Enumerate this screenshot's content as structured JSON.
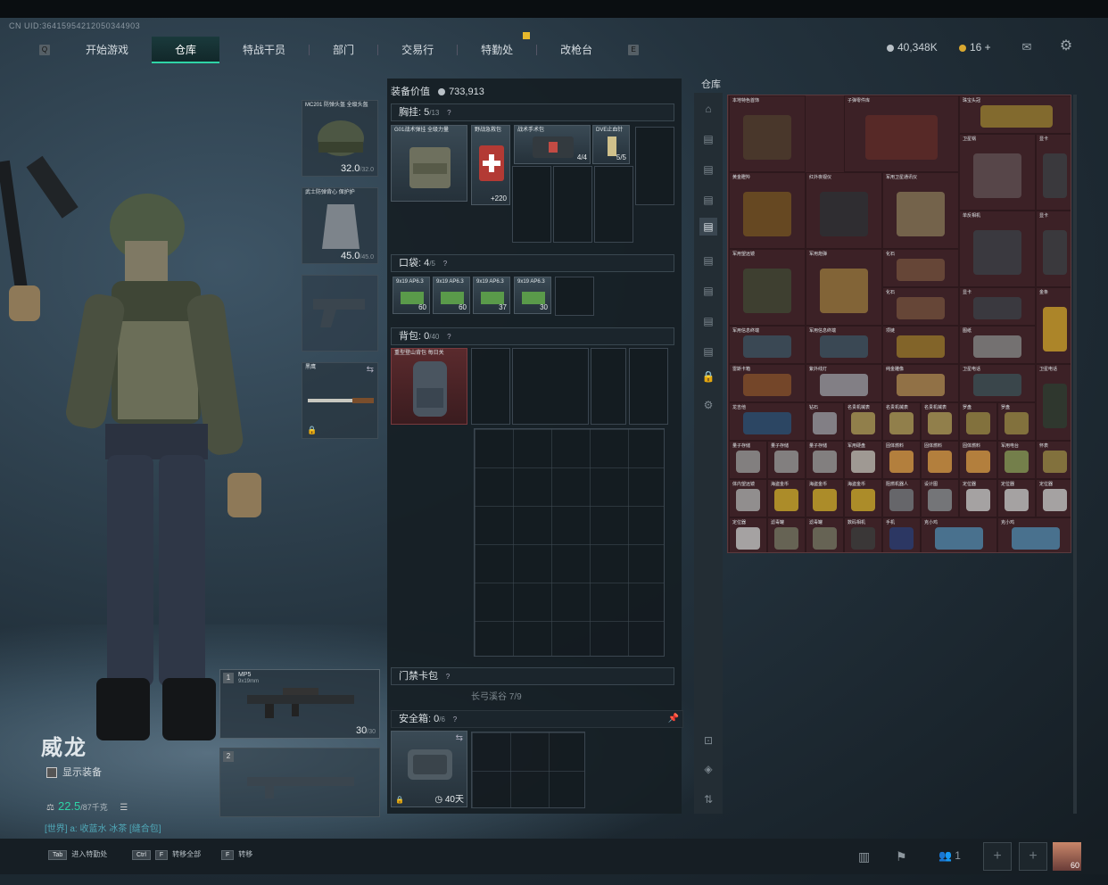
{
  "uid": "CN UID:3641595421205034490​3",
  "nav": {
    "items": [
      "开始游戏",
      "仓库",
      "特战干员",
      "部门",
      "交易行",
      "特勤处",
      "改枪台"
    ],
    "active": "仓库",
    "left_key": "Q",
    "right_key": "E"
  },
  "resources": {
    "currency": "40,348K",
    "coins": "16 +"
  },
  "operator": {
    "name": "威龙",
    "show_gear": "显示装备",
    "weight": "22.5",
    "weight_max": "/87千克",
    "chat": "[世界] a: 收蓝水 冰茶 [缝合包]"
  },
  "equipment": {
    "helmet": {
      "label": "MC201 防弹头盔 全级头盔",
      "value": "32.0",
      "max": "/32.0"
    },
    "armor": {
      "label": "武士防弹背心 保护护",
      "value": "45.0",
      "max": "/45.0"
    },
    "melee": {
      "label": "黑鹰"
    },
    "weapon1": {
      "slot": "1",
      "name": "MP5",
      "ammo_type": "9x19mm",
      "ammo": "30",
      "ammo_max": "/30"
    },
    "weapon2": {
      "slot": "2"
    }
  },
  "loadout": {
    "value_label": "装备价值",
    "value": "733,913",
    "chest": {
      "title": "胸挂:",
      "count": "5",
      "max": "/13"
    },
    "chest_items": [
      {
        "label": "G01战术弹挂 全级力量"
      },
      {
        "label": "野战急救包",
        "count": "+220"
      },
      {
        "label": "战术手术包",
        "count": "4/4"
      },
      {
        "label": "DVE止血针",
        "count": "5/5"
      }
    ],
    "pocket": {
      "title": "口袋:",
      "count": "4",
      "max": "/5"
    },
    "pocket_items": [
      {
        "label": "9x19 AP6.3",
        "count": "60"
      },
      {
        "label": "9x19 AP6.3",
        "count": "60"
      },
      {
        "label": "9x19 AP6.3",
        "count": "37"
      },
      {
        "label": "9x19 AP6.3",
        "count": "30"
      }
    ],
    "backpack": {
      "title": "背包:",
      "count": "0",
      "max": "/40",
      "label": "重型登山背包 每日关"
    },
    "keycard": {
      "title": "门禁卡包",
      "sub": "长弓溪谷 7/9"
    },
    "safebox": {
      "title": "安全箱:",
      "count": "0",
      "max": "/6",
      "duration": "40天"
    }
  },
  "stash": {
    "title": "仓库",
    "items": [
      {
        "label": "本地特色首饰"
      },
      {
        "label": "子弹零件库"
      },
      {
        "label": "珠宝头冠"
      },
      {
        "label": "卫星锅"
      },
      {
        "label": "显卡"
      },
      {
        "label": "黄金瞪羚"
      },
      {
        "label": "红外夜视仪"
      },
      {
        "label": "军用卫星通讯仪"
      },
      {
        "label": "单反相机"
      },
      {
        "label": "显卡"
      },
      {
        "label": "军用望远镜"
      },
      {
        "label": "军用炮弹"
      },
      {
        "label": "化石"
      },
      {
        "label": "化石"
      },
      {
        "label": "显卡"
      },
      {
        "label": "金条"
      },
      {
        "label": "军用信息终端"
      },
      {
        "label": "军用信息终端"
      },
      {
        "label": "项链"
      },
      {
        "label": "图纸"
      },
      {
        "label": "雷斯卡箱"
      },
      {
        "label": "紫外线灯"
      },
      {
        "label": "纯金雕像"
      },
      {
        "label": "卫星电话"
      },
      {
        "label": "卫星电话"
      },
      {
        "label": "龙吉他"
      },
      {
        "label": "钻石"
      },
      {
        "label": "名贵机械表"
      },
      {
        "label": "名贵机械表"
      },
      {
        "label": "名贵机械表"
      },
      {
        "label": "罗盘"
      },
      {
        "label": "罗盘"
      },
      {
        "label": "量子存储"
      },
      {
        "label": "量子存储"
      },
      {
        "label": "量子存储"
      },
      {
        "label": "军用硬盘"
      },
      {
        "label": "固体燃料"
      },
      {
        "label": "固体燃料"
      },
      {
        "label": "固体燃料"
      },
      {
        "label": "军用电台"
      },
      {
        "label": "怀表"
      },
      {
        "label": "体内望远镜"
      },
      {
        "label": "海盗金币"
      },
      {
        "label": "海盗金币"
      },
      {
        "label": "海盗金币"
      },
      {
        "label": "阻燃机器人"
      },
      {
        "label": "设计图"
      },
      {
        "label": "定位器"
      },
      {
        "label": "定位器"
      },
      {
        "label": "定位器"
      },
      {
        "label": "定位器"
      },
      {
        "label": "滤毒罐"
      },
      {
        "label": "滤毒罐"
      },
      {
        "label": "数码相机"
      },
      {
        "label": "手机"
      },
      {
        "label": "克小鸡"
      },
      {
        "label": "克小鸡"
      }
    ]
  },
  "bottom": {
    "hints": [
      {
        "keys": [
          "Tab"
        ],
        "text": "进入特勤处"
      },
      {
        "keys": [
          "Ctrl",
          "F"
        ],
        "text": "转移全部"
      },
      {
        "keys": [
          "F"
        ],
        "text": "转移"
      }
    ],
    "party": "1",
    "level": "60"
  },
  "colors": {
    "accent": "#2fd4a6",
    "stash_bg": "#3c2126",
    "gold": "#c9a640"
  }
}
